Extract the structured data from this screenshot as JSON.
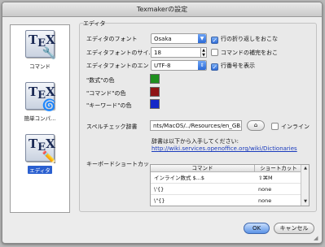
{
  "window": {
    "title": "Texmakerの設定"
  },
  "sidebar": {
    "items": [
      {
        "label": "コマンド",
        "icon": "wrench-icon",
        "selected": false
      },
      {
        "label": "簡単コンパ...",
        "icon": "spiral-icon",
        "selected": false
      },
      {
        "label": "エディタ",
        "icon": "pencil-icon",
        "selected": true
      }
    ]
  },
  "editor": {
    "group_title": "エディタ",
    "font_label": "エディタのフォント",
    "font_value": "Osaka",
    "size_label": "エディタフォントのサイ.",
    "size_value": "18",
    "encoding_label": "エディタフォントのエン",
    "encoding_value": "UTF-8",
    "wrap_label": "行の折り返しをおこな",
    "wrap_checked": true,
    "completion_label": "コマンドの補完をおこ",
    "completion_checked": false,
    "linenum_label": "行番号を表示",
    "linenum_checked": true,
    "numbers_color_label": "\"数式\"の色",
    "command_color_label": "\"コマンド\"の色",
    "keyword_color_label": "\"キーワード\"の色",
    "colors": {
      "numbers": "#1f8f1f",
      "command": "#8e1414",
      "keyword": "#1428c8"
    }
  },
  "spell": {
    "label": "スペルチェック辞書",
    "path": "nts/MacOS/../Resources/en_GB.dic",
    "browse_icon": "folder-icon",
    "inline_label": "インライン",
    "inline_checked": false,
    "info_text": "辞書は以下から入手してください:",
    "link": "http://wiki.services.openoffice.org/wiki/Dictionaries"
  },
  "shortcuts": {
    "label": "キーボードショートカッ",
    "columns": [
      "コマンド",
      "ショートカット"
    ],
    "rows": [
      {
        "command": "インライン数式 $...$",
        "shortcut": "⇧⌘M"
      },
      {
        "command": "\\'{}",
        "shortcut": "none"
      },
      {
        "command": "\\\"{}",
        "shortcut": "none"
      }
    ]
  },
  "buttons": {
    "ok": "OK",
    "cancel": "キャンセル"
  }
}
